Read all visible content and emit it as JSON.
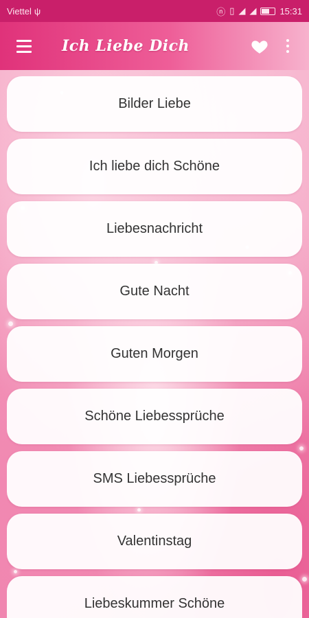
{
  "status_bar": {
    "carrier": "Viettel",
    "usb_icon": "usb-icon",
    "icons": [
      "nfc-icon",
      "vibrate-icon",
      "4g-signal-icon",
      "wifi-signal-icon",
      "battery-icon"
    ],
    "time": "15:31"
  },
  "app_bar": {
    "title": "Ich Liebe Dich",
    "menu_icon": "hamburger-menu-icon",
    "favorite_icon": "heart-icon",
    "overflow_icon": "more-vert-icon",
    "color": "#e0327a"
  },
  "menu": {
    "items": [
      {
        "label": "Bilder Liebe"
      },
      {
        "label": "Ich liebe dich Schöne"
      },
      {
        "label": "Liebesnachricht"
      },
      {
        "label": "Gute Nacht"
      },
      {
        "label": "Guten Morgen"
      },
      {
        "label": "Schöne Liebessprüche"
      },
      {
        "label": "SMS Liebessprüche"
      },
      {
        "label": "Valentinstag"
      },
      {
        "label": "Liebeskummer Schöne"
      }
    ]
  }
}
